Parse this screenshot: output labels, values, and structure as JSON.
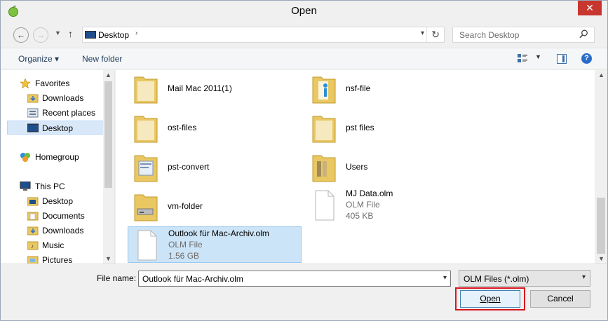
{
  "window": {
    "title": "Open",
    "close_glyph": "✕"
  },
  "navbar": {
    "address_crumb": "Desktop",
    "search_placeholder": "Search Desktop"
  },
  "toolbar": {
    "organize_label": "Organize ▾",
    "new_folder_label": "New folder"
  },
  "nav_pane": {
    "items": [
      {
        "label": "Favorites",
        "icon": "star-icon"
      },
      {
        "label": "Downloads",
        "icon": "downloads-folder-icon"
      },
      {
        "label": "Recent places",
        "icon": "recent-places-icon"
      },
      {
        "label": "Desktop",
        "icon": "desktop-icon",
        "selected": true
      },
      {
        "label": "Homegroup",
        "icon": "homegroup-icon"
      },
      {
        "label": "This PC",
        "icon": "this-pc-icon"
      },
      {
        "label": "Desktop",
        "icon": "folder-icon"
      },
      {
        "label": "Documents",
        "icon": "folder-icon"
      },
      {
        "label": "Downloads",
        "icon": "folder-icon"
      },
      {
        "label": "Music",
        "icon": "folder-icon"
      },
      {
        "label": "Pictures",
        "icon": "folder-icon"
      }
    ]
  },
  "files": [
    {
      "name": "Mail Mac 2011(1)",
      "kind": "folder"
    },
    {
      "name": "nsf-file",
      "kind": "folder"
    },
    {
      "name": "ost-files",
      "kind": "folder"
    },
    {
      "name": "pst files",
      "kind": "folder"
    },
    {
      "name": "pst-convert",
      "kind": "folder"
    },
    {
      "name": "Users",
      "kind": "folder"
    },
    {
      "name": "vm-folder",
      "kind": "folder"
    },
    {
      "name": "MJ Data.olm",
      "kind": "file",
      "type": "OLM File",
      "size": "405 KB"
    },
    {
      "name": "Outlook für Mac-Archiv.olm",
      "kind": "file",
      "type": "OLM File",
      "size": "1.56 GB",
      "selected": true
    }
  ],
  "bottom": {
    "file_name_label": "File name:",
    "file_name_value": "Outlook für Mac-Archiv.olm",
    "file_type_value": "OLM Files (*.olm)",
    "open_label": "Open",
    "cancel_label": "Cancel"
  },
  "colors": {
    "accent_selected": "#cce4f7",
    "highlight_box": "#d8141e"
  }
}
